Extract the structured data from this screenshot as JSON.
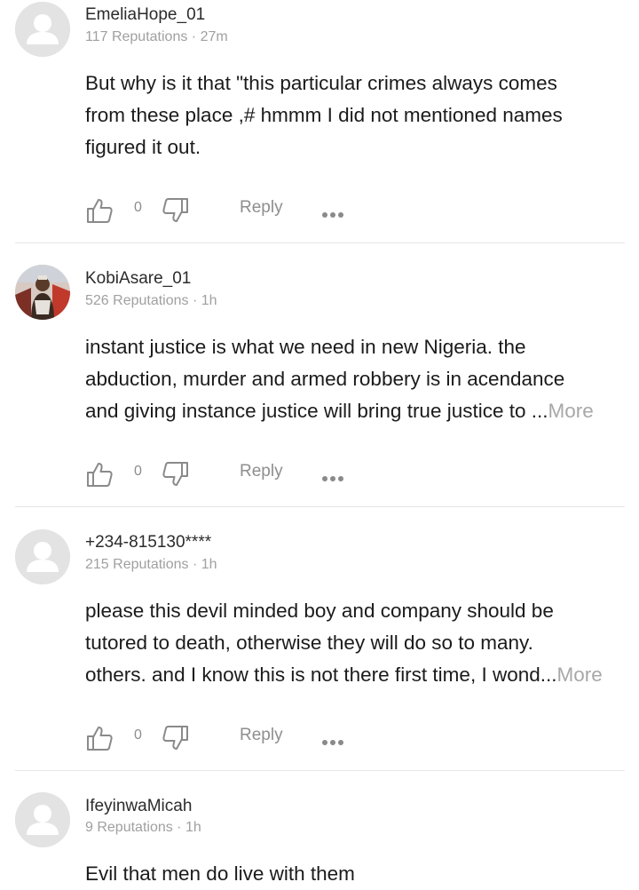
{
  "comments": [
    {
      "username": "EmeliaHope_01",
      "meta": "117 Reputations · 27m",
      "lines": [
        "But why is it that \"this particular crimes always comes",
        "from these place ,# hmmm I did not mentioned names",
        "figured it out."
      ],
      "more": "",
      "likes": "0",
      "reply_label": "Reply"
    },
    {
      "username": "KobiAsare_01",
      "meta": "526 Reputations · 1h",
      "lines": [
        "instant justice is what we need in new Nigeria.  the",
        "abduction,  murder and armed robbery is in acendance",
        "and giving instance justice will bring true justice to ..."
      ],
      "more": "More",
      "likes": "0",
      "reply_label": "Reply"
    },
    {
      "username": "+234-815130****",
      "meta": "215 Reputations · 1h",
      "lines": [
        "please this devil minded boy and company should be",
        "tutored  to death, otherwise they will do so to many.",
        "others. and I know this is not there first time, I wond..."
      ],
      "more": "More",
      "likes": "0",
      "reply_label": "Reply"
    },
    {
      "username": "IfeyinwaMicah",
      "meta": "9 Reputations · 1h",
      "lines": [
        "Evil that men do live with them"
      ],
      "more": "",
      "likes": "",
      "reply_label": ""
    }
  ],
  "icons": {
    "avatar_default": "user-placeholder-icon",
    "like": "thumbs-up-icon",
    "dislike": "thumbs-down-icon",
    "more": "more-options-icon"
  },
  "colors": {
    "text": "#1b1b1b",
    "muted": "#a0a0a0",
    "more_link": "#a8a8a8",
    "divider": "#e6e6e6",
    "avatar_bg": "#e3e3e3"
  }
}
